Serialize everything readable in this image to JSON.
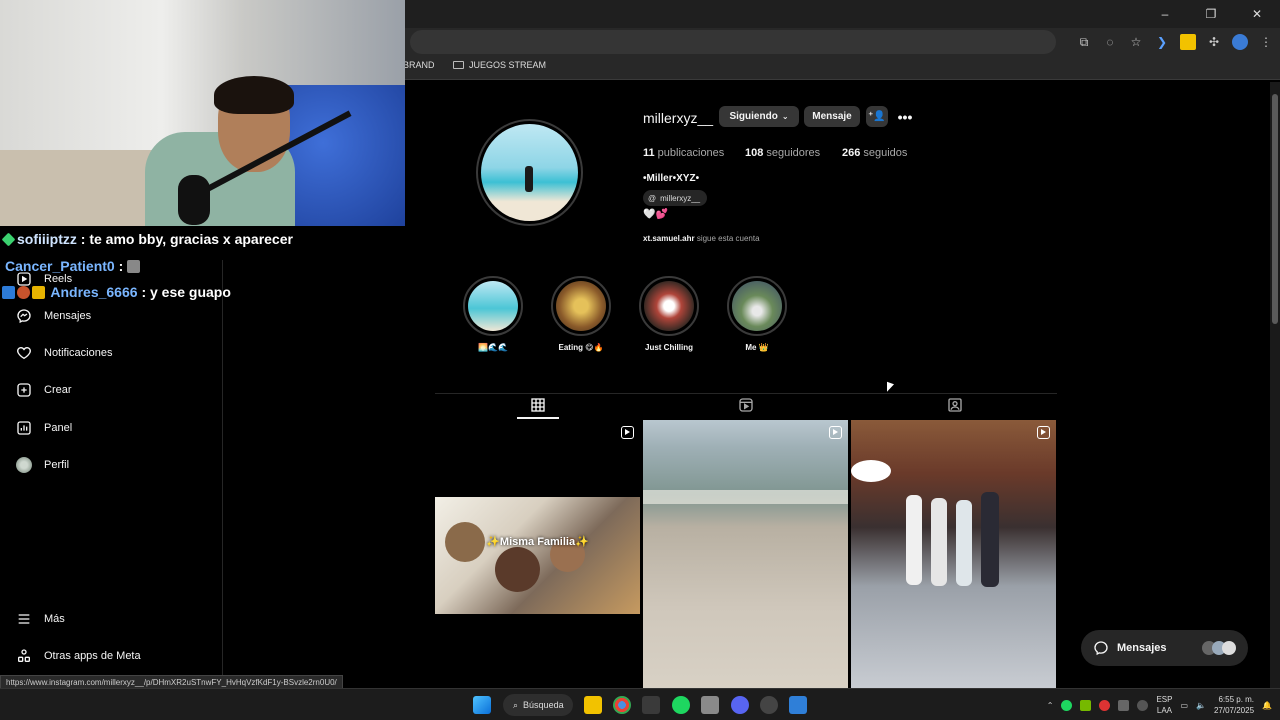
{
  "browser": {
    "bookmarks": [
      {
        "label": "BRAND"
      },
      {
        "label": "JUEGOS STREAM"
      }
    ],
    "window_controls": [
      "–",
      "❐",
      "✕"
    ],
    "status_url": "https://www.instagram.com/millerxyz__/p/DHmXR2uSTnwFY_HvHqVzfKdF1y-BSvzle2rn0U0/"
  },
  "chat": [
    {
      "user": "sofiiiptzz",
      "message": ": te amo bby, gracias x aparecer"
    },
    {
      "user": "Cancer_Patient0",
      "message": ":"
    },
    {
      "user": "Andres_6666",
      "message": ": y ese guapo"
    }
  ],
  "sidebar": {
    "items": [
      {
        "label": "Reels",
        "icon": "reels-icon"
      },
      {
        "label": "Mensajes",
        "icon": "messenger-icon"
      },
      {
        "label": "Notificaciones",
        "icon": "heart-icon"
      },
      {
        "label": "Crear",
        "icon": "plus-square-icon"
      },
      {
        "label": "Panel",
        "icon": "bar-chart-icon"
      },
      {
        "label": "Perfil",
        "icon": "avatar"
      }
    ],
    "bottom": [
      {
        "label": "Más",
        "icon": "hamburger-icon"
      },
      {
        "label": "Otras apps de Meta",
        "icon": "meta-apps-icon"
      }
    ]
  },
  "profile": {
    "username": "millerxyz__",
    "following_button": "Siguiendo",
    "message_button": "Mensaje",
    "stats": {
      "posts_count": "11",
      "posts_label": "publicaciones",
      "followers_count": "108",
      "followers_label": "seguidores",
      "following_count": "266",
      "following_label": "seguidos"
    },
    "display_name": "•Miller•XYZ•",
    "threads_handle": "millerxyz__",
    "bio": "🤍💕",
    "followed_by_user": "xt.samuel.ahr",
    "followed_by_text": "sigue esta cuenta"
  },
  "highlights": [
    {
      "label": "🌅🌊🌊"
    },
    {
      "label": "Eating 😋🔥"
    },
    {
      "label": "Just Chilling"
    },
    {
      "label": "Me 👑"
    }
  ],
  "posts": [
    {
      "caption": "✨Misma Familia✨"
    }
  ],
  "floating_messages": {
    "label": "Mensajes"
  },
  "taskbar": {
    "search_label": "Búsqueda",
    "lang_top": "ESP",
    "lang_bottom": "LAA",
    "time": "6:55 p. m.",
    "date": "27/07/2025"
  },
  "colors": {
    "background": "#000000",
    "button": "#363636",
    "secondary_text": "#a8a8a8",
    "chat_user": "#7ab6ff"
  }
}
